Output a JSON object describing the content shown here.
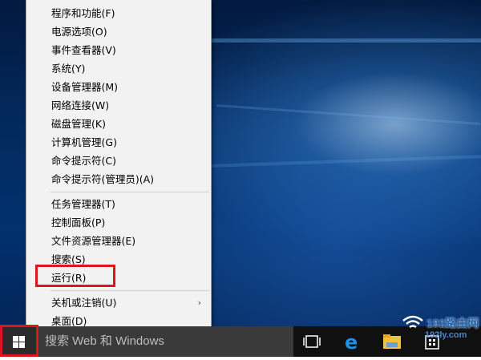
{
  "context_menu": {
    "group1": [
      {
        "label": "程序和功能(F)"
      },
      {
        "label": "电源选项(O)"
      },
      {
        "label": "事件查看器(V)"
      },
      {
        "label": "系统(Y)"
      },
      {
        "label": "设备管理器(M)"
      },
      {
        "label": "网络连接(W)"
      },
      {
        "label": "磁盘管理(K)"
      },
      {
        "label": "计算机管理(G)"
      },
      {
        "label": "命令提示符(C)"
      },
      {
        "label": "命令提示符(管理员)(A)"
      }
    ],
    "group2": [
      {
        "label": "任务管理器(T)"
      },
      {
        "label": "控制面板(P)"
      },
      {
        "label": "文件资源管理器(E)"
      },
      {
        "label": "搜索(S)"
      },
      {
        "label": "运行(R)"
      }
    ],
    "group3": [
      {
        "label": "关机或注销(U)",
        "submenu_arrow": "›"
      },
      {
        "label": "桌面(D)"
      }
    ]
  },
  "taskbar": {
    "search_placeholder": "搜索 Web 和 Windows",
    "icons": [
      "start-windows-icon",
      "task-view-icon",
      "edge-browser-icon",
      "file-explorer-icon",
      "store-icon"
    ]
  },
  "watermark": {
    "brand": "192路由网",
    "url": "192ly.com"
  },
  "colors": {
    "highlight_border": "#e0141e",
    "taskbar": "#101010",
    "menu_bg": "#f2f2f2"
  }
}
